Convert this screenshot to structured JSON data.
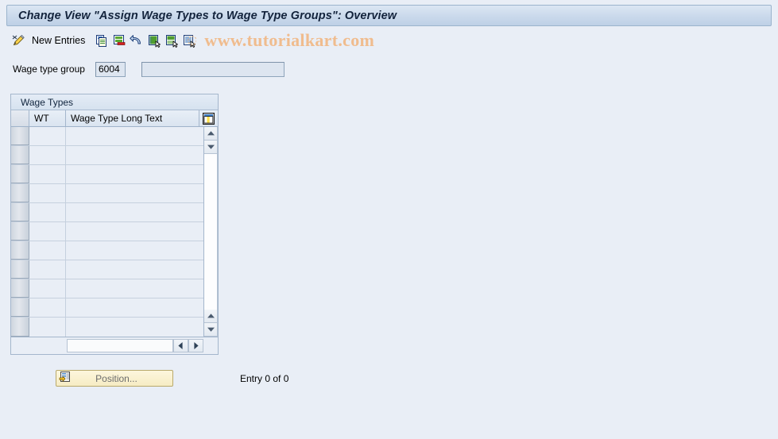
{
  "window": {
    "title": "Change View \"Assign Wage Types to Wage Type Groups\": Overview"
  },
  "toolbar": {
    "edit_icon": "pencil-icon",
    "new_entries_label": "New Entries",
    "buttons": [
      {
        "icon": "copy-icon",
        "name": "copy-as-button"
      },
      {
        "icon": "delete-icon",
        "name": "delete-button"
      },
      {
        "icon": "undo-icon",
        "name": "undo-change-button"
      },
      {
        "icon": "select-all-icon",
        "name": "select-all-button"
      },
      {
        "icon": "deselect-all-icon",
        "name": "deselect-all-button"
      },
      {
        "icon": "select-block-icon",
        "name": "select-block-button"
      }
    ],
    "watermark": "www.tutorialkart.com"
  },
  "selection": {
    "wage_type_group_label": "Wage type group",
    "wage_type_group_key": "6004",
    "wage_type_group_text": "",
    "wage_type_group_text_placeholder": ""
  },
  "table": {
    "group_title": "Wage Types",
    "columns": [
      {
        "key": "wt",
        "label": "WT"
      },
      {
        "key": "long_text",
        "label": "Wage Type Long Text"
      }
    ],
    "config_icon": "table-settings-icon",
    "rows": [
      {
        "wt": "",
        "long_text": ""
      },
      {
        "wt": "",
        "long_text": ""
      },
      {
        "wt": "",
        "long_text": ""
      },
      {
        "wt": "",
        "long_text": ""
      },
      {
        "wt": "",
        "long_text": ""
      },
      {
        "wt": "",
        "long_text": ""
      },
      {
        "wt": "",
        "long_text": ""
      },
      {
        "wt": "",
        "long_text": ""
      },
      {
        "wt": "",
        "long_text": ""
      },
      {
        "wt": "",
        "long_text": ""
      },
      {
        "wt": "",
        "long_text": ""
      }
    ]
  },
  "footer": {
    "position_label": "Position...",
    "position_icon": "position-icon",
    "entry_status": "Entry 0 of 0"
  },
  "colors": {
    "page_background": "#e9eef6",
    "titlebar_border": "#9bb4cd",
    "watermark": "#f0bc8e",
    "button_yellow": "#f6ecc4",
    "grid_line": "#c5d0de"
  }
}
